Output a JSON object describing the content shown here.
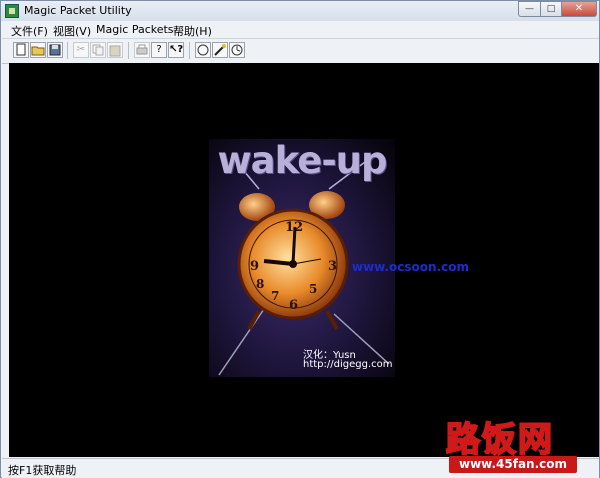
{
  "window": {
    "title": "Magic Packet Utility",
    "buttons": {
      "minimize": "—",
      "maximize": "□",
      "close": "✕"
    }
  },
  "menu": [
    {
      "label": "文件(F)"
    },
    {
      "label": "视图(V)"
    },
    {
      "label": "Magic Packets"
    },
    {
      "label": "帮助(H)"
    }
  ],
  "toolbar": {
    "icons": [
      "new-file-icon",
      "open-folder-icon",
      "save-icon",
      "cut-icon",
      "copy-icon",
      "paste-icon",
      "print-icon",
      "about-icon",
      "context-help-icon",
      "send-packet-icon",
      "wand-icon",
      "clock-icon"
    ]
  },
  "splash": {
    "heading": "wake-up",
    "credit_line1": "汉化：Yusn",
    "credit_line2": "http://digegg.com",
    "site_text": "www.ocsoon.com"
  },
  "watermark": {
    "brand": "路饭网",
    "url": "www.45fan.com"
  },
  "status": {
    "text": "按F1获取帮助"
  }
}
